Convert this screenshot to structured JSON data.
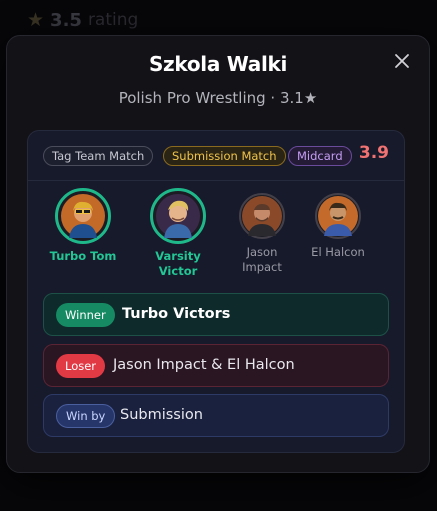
{
  "background": {
    "rating_value": "3.5",
    "rating_label": "rating"
  },
  "modal": {
    "title": "Szkola Walki",
    "subtitle": "Polish Pro Wrestling · 3.1★",
    "close_icon": "close-icon"
  },
  "match": {
    "chips": {
      "type": "Tag Team Match",
      "stipulation": "Submission Match",
      "position": "Midcard"
    },
    "score": "3.9",
    "wrestlers": [
      {
        "name": "Turbo Tom",
        "winner": true
      },
      {
        "name": "Varsity Victor",
        "winner": true
      },
      {
        "name": "Jason Impact",
        "winner": false
      },
      {
        "name": "El Halcon",
        "winner": false
      }
    ],
    "results": {
      "winner_label": "Winner",
      "winner_value": "Turbo Victors",
      "loser_label": "Loser",
      "loser_value": "Jason Impact & El Halcon",
      "winby_label": "Win by",
      "winby_value": "Submission"
    }
  },
  "colors": {
    "accent_win": "#1eb88a",
    "accent_lose": "#e23a45",
    "score": "#f07272",
    "stipulation": "#f0c44a",
    "position": "#c59cf4"
  }
}
